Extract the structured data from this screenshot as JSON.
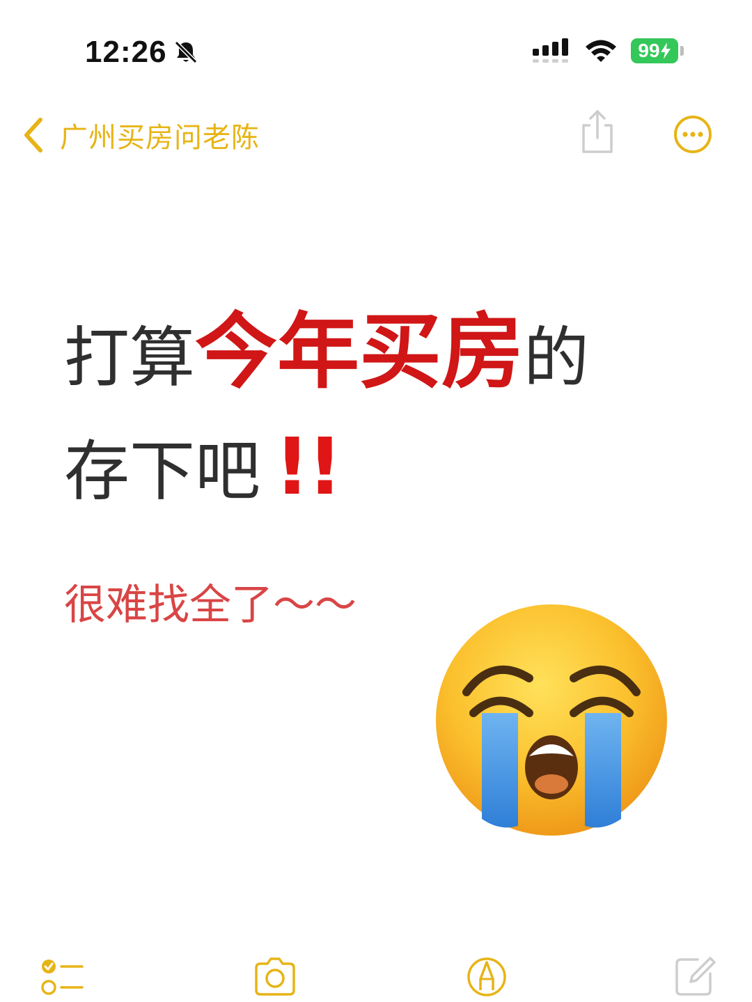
{
  "status_bar": {
    "time": "12:26",
    "battery": "99",
    "icons": [
      "bell-slash-icon",
      "cellular-signal-icon",
      "wifi-icon",
      "battery-charging-icon"
    ]
  },
  "nav": {
    "back_label": "广州买房问老陈",
    "icons": [
      "chevron-left-icon",
      "share-icon",
      "more-icon"
    ],
    "accent_color": "#e7b416"
  },
  "note": {
    "line1_prefix": "打算",
    "line1_highlight": "今年买房",
    "line1_suffix": "的",
    "line2_text": "存下吧",
    "line2_exclaim": "!!",
    "subline": "很难找全了～～",
    "emoji": "loudly-crying-face-emoji",
    "highlight_color": "#d01616"
  },
  "toolbar": {
    "icons": [
      "checklist-icon",
      "camera-icon",
      "markup-pen-icon",
      "compose-icon"
    ]
  }
}
